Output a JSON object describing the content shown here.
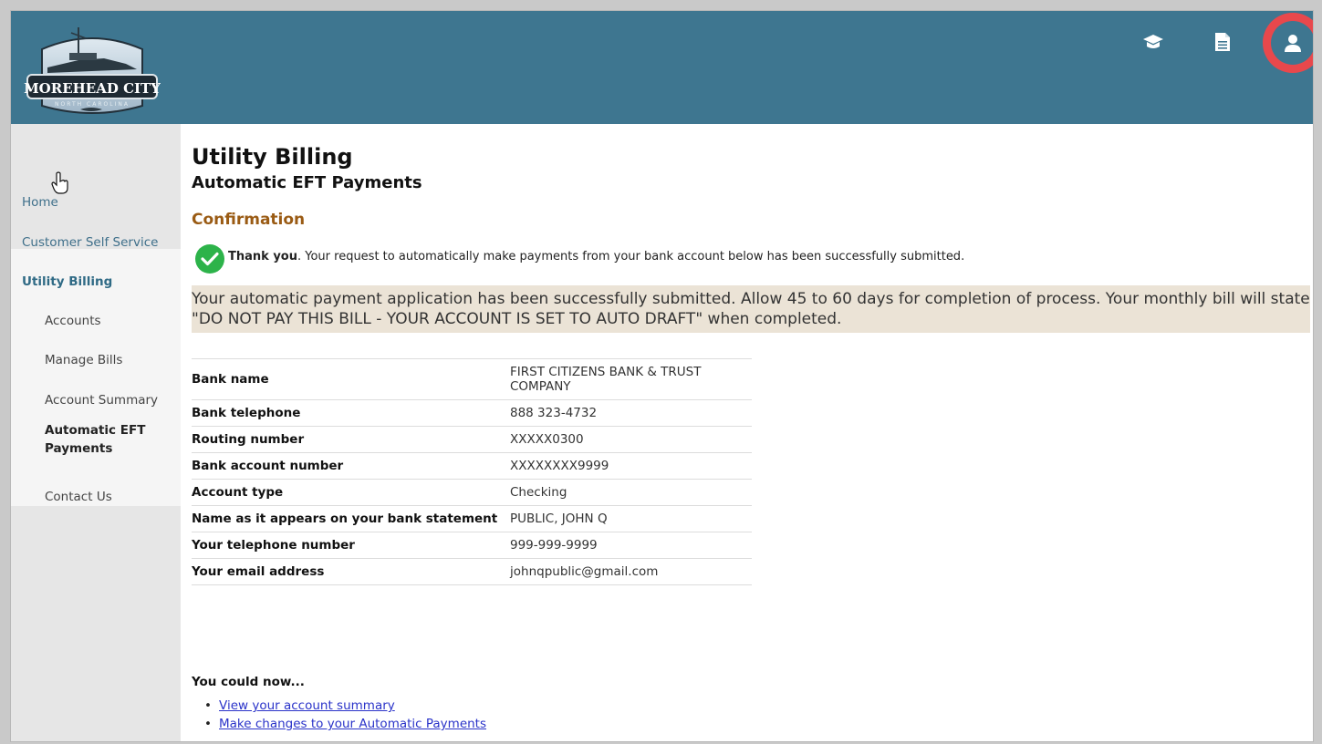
{
  "header": {
    "logo": {
      "name": "MOREHEAD CITY",
      "subtitle": "NORTH CAROLINA"
    },
    "icons": [
      "graduation-cap-icon",
      "document-icon",
      "user-profile-icon"
    ],
    "bg_color": "#3e7690",
    "highlight_color": "#e8484c"
  },
  "sidebar": {
    "home": "Home",
    "customer_self_service": "Customer Self Service",
    "utility_billing": "Utility Billing",
    "items": [
      {
        "label": "Accounts"
      },
      {
        "label": "Manage Bills"
      },
      {
        "label": "Account Summary"
      },
      {
        "label": "Automatic EFT Payments",
        "active": true
      },
      {
        "label": "Contact Us"
      }
    ]
  },
  "main": {
    "title": "Utility Billing",
    "subtitle": "Automatic EFT Payments",
    "section": "Confirmation",
    "thanks_bold": "Thank you",
    "thanks_rest": ". Your request to automatically make payments from your bank account below has been successfully submitted.",
    "notice": "Your automatic payment application has been successfully submitted. Allow 45 to 60 days for completion of process. Your monthly bill will state \"DO NOT PAY THIS BILL - YOUR ACCOUNT IS SET TO AUTO DRAFT\" when completed.",
    "details": [
      {
        "label": "Bank name",
        "value": "FIRST CITIZENS BANK & TRUST COMPANY"
      },
      {
        "label": "Bank telephone",
        "value": "888 323-4732"
      },
      {
        "label": "Routing number",
        "value": "XXXXX0300"
      },
      {
        "label": "Bank account number",
        "value": "XXXXXXXX9999"
      },
      {
        "label": "Account type",
        "value": "Checking"
      },
      {
        "label": "Name as it appears on your bank statement",
        "value": "PUBLIC, JOHN Q"
      },
      {
        "label": "Your telephone number",
        "value": "999-999-9999"
      },
      {
        "label": "Your email address",
        "value": "johnqpublic@gmail.com"
      }
    ],
    "next_heading": "You could now...",
    "next_links": [
      "View your account summary",
      "Make changes to your Automatic Payments"
    ]
  }
}
